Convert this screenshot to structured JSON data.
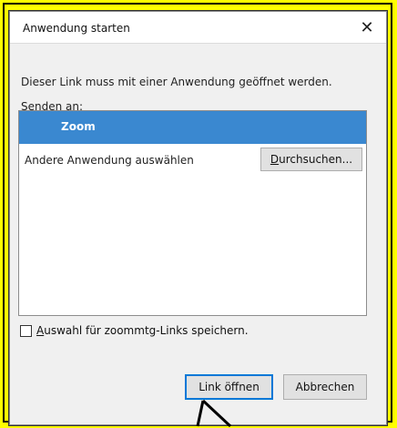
{
  "dialog": {
    "title": "Anwendung starten",
    "close_glyph": "✕",
    "message": "Dieser Link muss mit einer Anwendung geöffnet werden.",
    "send_to_label": "Senden an:",
    "apps": {
      "selected": "Zoom",
      "other": "Andere Anwendung auswählen"
    },
    "browse_button": {
      "first_letter": "D",
      "rest": "urchsuchen..."
    },
    "remember_checkbox": {
      "first_letter": "A",
      "rest": "uswahl für zoommtg-Links speichern.",
      "checked": false
    },
    "open_button": "Link öffnen",
    "cancel_button": "Abbrechen"
  },
  "colors": {
    "outer_background": "#ffff00",
    "selection": "#3a88d0",
    "focus_border": "#0078d7"
  }
}
